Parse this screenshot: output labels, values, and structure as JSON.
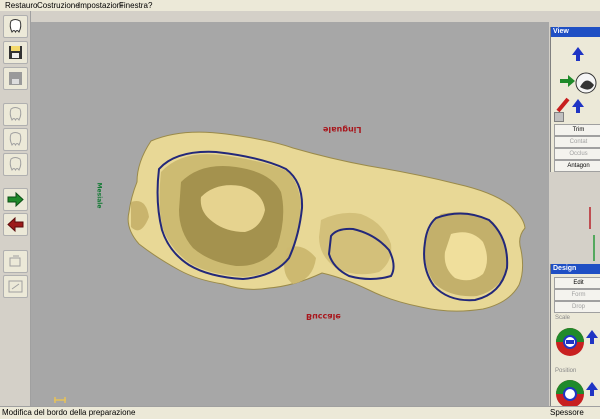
{
  "menu": {
    "restauro": "Restauro",
    "costruzione": "Costruzione",
    "impostazioni": "Impostazioni",
    "finestra": "Finestra",
    "help": "?"
  },
  "colors": {
    "model": "#e8d896",
    "margin_line": "#23287a",
    "viewport": "#a7a7a7",
    "label_red": "#a8161c",
    "label_green": "#147a35"
  },
  "labels3d": {
    "lingual": "Linguale",
    "buccal": "Buccale",
    "mesial": "Mesiale"
  },
  "view_panel": {
    "title": "View",
    "trim": "Trim",
    "contact": "Contat",
    "occlusion": "Occlus",
    "antagonist": "Antagon"
  },
  "design_panel": {
    "title": "Design",
    "edit": "Edit",
    "form": "Form",
    "drop": "Drop",
    "scale": "Scale",
    "position": "Position"
  },
  "status": {
    "message": "Modifica del bordo della preparazione",
    "right": "Spessore"
  }
}
